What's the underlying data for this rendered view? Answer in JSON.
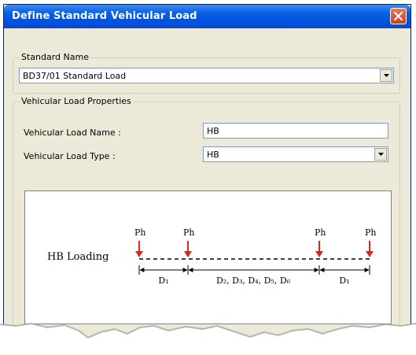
{
  "window": {
    "title": "Define Standard Vehicular Load"
  },
  "standard_name": {
    "group_label": "Standard Name",
    "selected": "BD37/01 Standard Load"
  },
  "properties": {
    "group_label": "Vehicular Load Properties",
    "name_label": "Vehicular Load Name :",
    "name_value": "HB",
    "type_label": "Vehicular Load Type :",
    "type_value": "HB"
  },
  "diagram": {
    "caption": "HB Loading",
    "load_labels": [
      "Ph",
      "Ph",
      "Ph",
      "Ph"
    ],
    "spacing_labels": [
      "D₁",
      "D₂, D₃, D₄, D₅, D₆",
      "D₁"
    ],
    "arrow_color": "#d9261c"
  },
  "icons": {
    "close": "close-icon",
    "dropdown": "chevron-down-icon",
    "load": "down-arrow-icon"
  }
}
